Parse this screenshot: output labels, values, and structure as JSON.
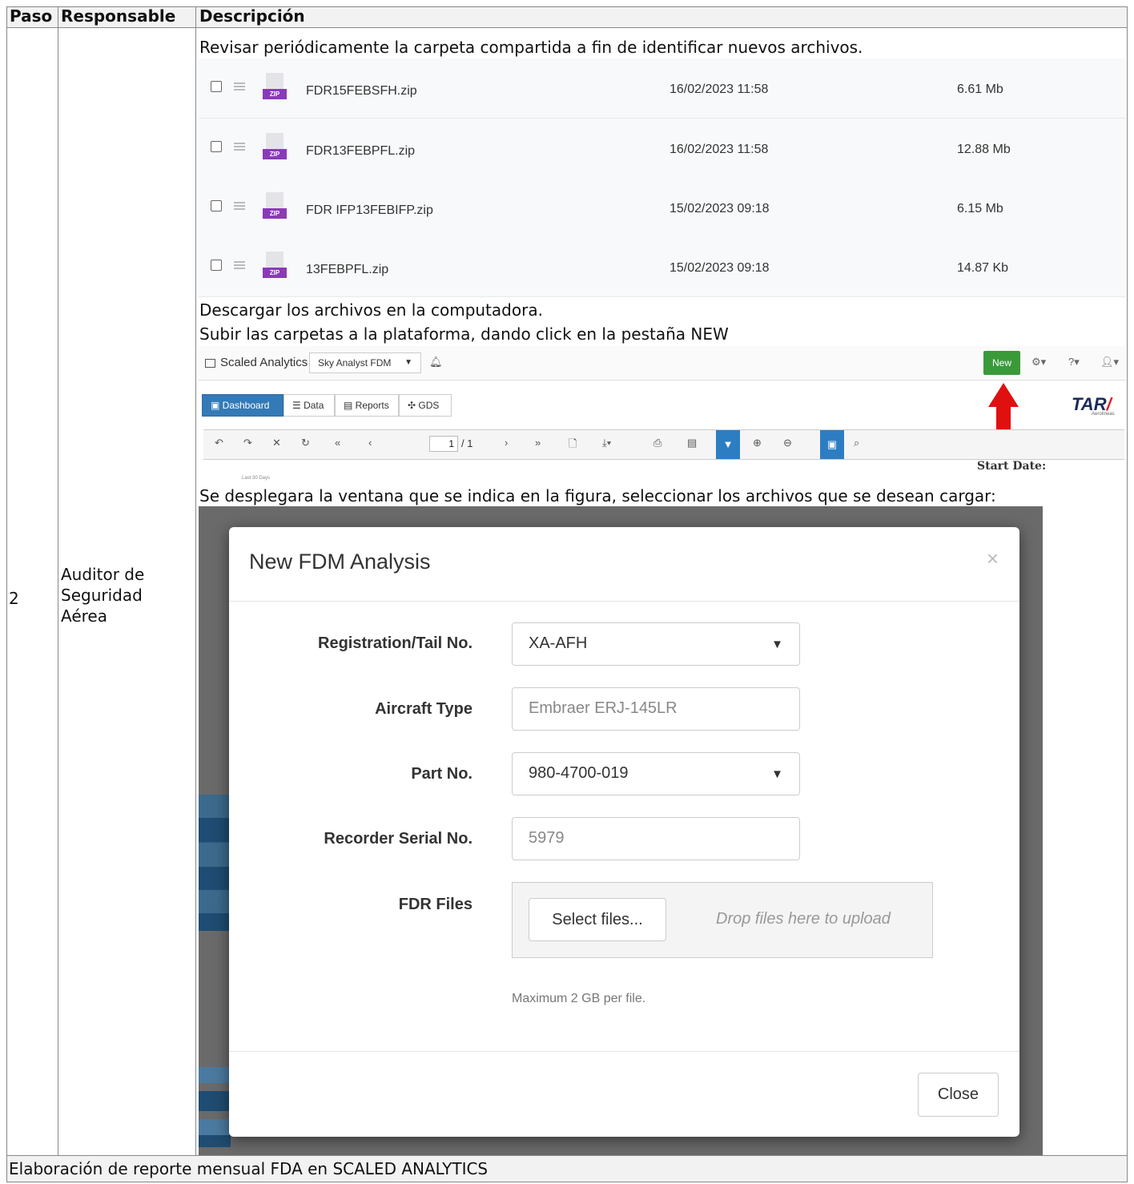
{
  "table": {
    "headers": {
      "paso": "Paso",
      "responsable": "Responsable",
      "descripcion": "Descripción"
    },
    "step_number": "2",
    "responsible_lines": [
      "Auditor de",
      "Seguridad",
      "Aérea"
    ],
    "instructions": {
      "check_folder": "Revisar periódicamente la carpeta compartida a fin de identificar nuevos archivos.",
      "download": "Descargar los archivos en la computadora.",
      "upload": "Subir las carpetas a la plataforma, dando click en la pestaña NEW",
      "select_files": "Se desplegara la ventana que se indica en la figura, seleccionar los archivos que se desean cargar:"
    },
    "footer": "Elaboración de reporte mensual FDA en SCALED ANALYTICS"
  },
  "files": [
    {
      "name": "FDR15FEBSFH.zip",
      "date": "16/02/2023 11:58",
      "size": "6.61 Mb"
    },
    {
      "name": "FDR13FEBPFL.zip",
      "date": "16/02/2023 11:58",
      "size": "12.88 Mb"
    },
    {
      "name": "FDR IFP13FEBIFP.zip",
      "date": "15/02/2023 09:18",
      "size": "6.15 Mb"
    },
    {
      "name": "13FEBPFL.zip",
      "date": "15/02/2023 09:18",
      "size": "14.87 Kb"
    }
  ],
  "zip_tag": "ZIP",
  "app": {
    "brand": "Scaled Analytics",
    "project_select": "Sky Analyst FDM",
    "new_button": "New",
    "tabs": [
      "Dashboard",
      "Data",
      "Reports",
      "GDS"
    ],
    "logo": "TAR",
    "logo_sub": "Aerolíneas",
    "page_current": "1",
    "page_total": "/ 1",
    "start_date_label": "Start Date:",
    "last30": "Last 30 Days",
    "accent_color": "#337ab7",
    "new_color": "#3a9a3a"
  },
  "modal": {
    "title": "New FDM Analysis",
    "close_x": "×",
    "registration_label": "Registration/Tail No.",
    "registration_value": "XA-AFH",
    "aircraft_type_label": "Aircraft Type",
    "aircraft_type_value": "Embraer ERJ-145LR",
    "part_no_label": "Part No.",
    "part_no_value": "980-4700-019",
    "serial_label": "Recorder Serial No.",
    "serial_value": "5979",
    "fdr_files_label": "FDR Files",
    "select_files_button": "Select files...",
    "drop_hint": "Drop files here to upload",
    "max_note": "Maximum 2 GB per file.",
    "close_button": "Close"
  }
}
